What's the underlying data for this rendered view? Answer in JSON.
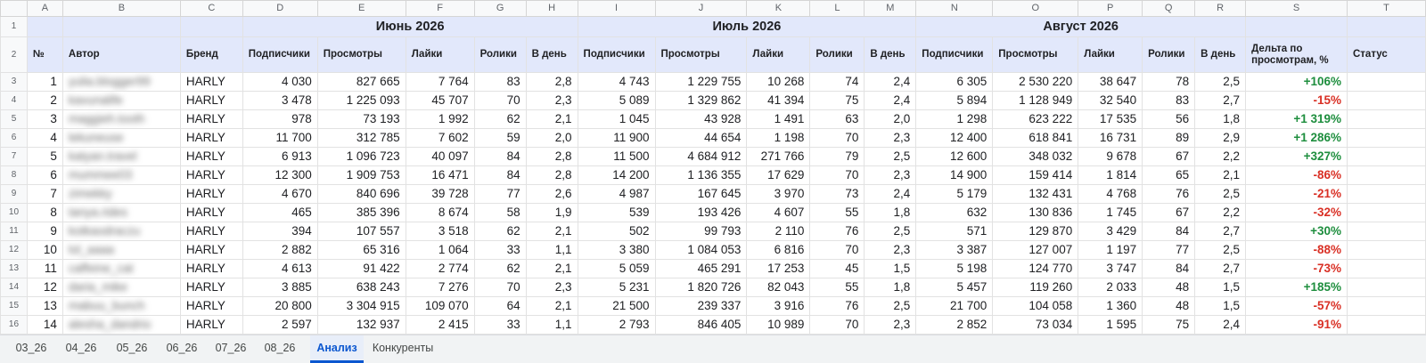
{
  "columns": [
    "A",
    "B",
    "C",
    "D",
    "E",
    "F",
    "G",
    "H",
    "I",
    "J",
    "K",
    "L",
    "M",
    "N",
    "O",
    "P",
    "Q",
    "R",
    "S",
    "T"
  ],
  "header": {
    "row_numbers": [
      "1",
      "2"
    ],
    "months": [
      "Июнь 2026",
      "Июль 2026",
      "Август 2026"
    ],
    "labels": {
      "no": "№",
      "author": "Автор",
      "brand": "Бренд",
      "subscribers": "Подписчики",
      "views": "Просмотры",
      "likes": "Лайки",
      "videos": "Ролики",
      "per_day": "В день",
      "delta": "Дельта по просмотрам, %",
      "status": "Статус"
    }
  },
  "rows": [
    {
      "rn": "3",
      "no": "1",
      "author": "yulia.blogger99",
      "brand": "HARLY",
      "m1": [
        "4 030",
        "827 665",
        "7 764",
        "83",
        "2,8"
      ],
      "m2": [
        "4 743",
        "1 229 755",
        "10 268",
        "74",
        "2,4"
      ],
      "m3": [
        "6 305",
        "2 530 220",
        "38 647",
        "78",
        "2,5"
      ],
      "delta": "+106%",
      "status": ""
    },
    {
      "rn": "4",
      "no": "2",
      "author": "kavunalife",
      "brand": "HARLY",
      "m1": [
        "3 478",
        "1 225 093",
        "45 707",
        "70",
        "2,3"
      ],
      "m2": [
        "5 089",
        "1 329 862",
        "41 394",
        "75",
        "2,4"
      ],
      "m3": [
        "5 894",
        "1 128 949",
        "32 540",
        "83",
        "2,7"
      ],
      "delta": "-15%",
      "status": ""
    },
    {
      "rn": "5",
      "no": "3",
      "author": "maggieh.tooth",
      "brand": "HARLY",
      "m1": [
        "978",
        "73 193",
        "1 992",
        "62",
        "2,1"
      ],
      "m2": [
        "1 045",
        "43 928",
        "1 491",
        "63",
        "2,0"
      ],
      "m3": [
        "1 298",
        "623 222",
        "17 535",
        "56",
        "1,8"
      ],
      "delta": "+1 319%",
      "status": ""
    },
    {
      "rn": "6",
      "no": "4",
      "author": "lekuneuse",
      "brand": "HARLY",
      "m1": [
        "11 700",
        "312 785",
        "7 602",
        "59",
        "2,0"
      ],
      "m2": [
        "11 900",
        "44 654",
        "1 198",
        "70",
        "2,3"
      ],
      "m3": [
        "12 400",
        "618 841",
        "16 731",
        "89",
        "2,9"
      ],
      "delta": "+1 286%",
      "status": ""
    },
    {
      "rn": "7",
      "no": "5",
      "author": "katyan.travel",
      "brand": "HARLY",
      "m1": [
        "6 913",
        "1 096 723",
        "40 097",
        "84",
        "2,8"
      ],
      "m2": [
        "11 500",
        "4 684 912",
        "271 766",
        "79",
        "2,5"
      ],
      "m3": [
        "12 600",
        "348 032",
        "9 678",
        "67",
        "2,2"
      ],
      "delta": "+327%",
      "status": ""
    },
    {
      "rn": "8",
      "no": "6",
      "author": "mummee03",
      "brand": "HARLY",
      "m1": [
        "12 300",
        "1 909 753",
        "16 471",
        "84",
        "2,8"
      ],
      "m2": [
        "14 200",
        "1 136 355",
        "17 629",
        "70",
        "2,3"
      ],
      "m3": [
        "14 900",
        "159 414",
        "1 814",
        "65",
        "2,1"
      ],
      "delta": "-86%",
      "status": ""
    },
    {
      "rn": "9",
      "no": "7",
      "author": "zimekky",
      "brand": "HARLY",
      "m1": [
        "4 670",
        "840 696",
        "39 728",
        "77",
        "2,6"
      ],
      "m2": [
        "4 987",
        "167 645",
        "3 970",
        "73",
        "2,4"
      ],
      "m3": [
        "5 179",
        "132 431",
        "4 768",
        "76",
        "2,5"
      ],
      "delta": "-21%",
      "status": ""
    },
    {
      "rn": "10",
      "no": "8",
      "author": "tanya.rides",
      "brand": "HARLY",
      "m1": [
        "465",
        "385 396",
        "8 674",
        "58",
        "1,9"
      ],
      "m2": [
        "539",
        "193 426",
        "4 607",
        "55",
        "1,8"
      ],
      "m3": [
        "632",
        "130 836",
        "1 745",
        "67",
        "2,2"
      ],
      "delta": "-32%",
      "status": ""
    },
    {
      "rn": "11",
      "no": "9",
      "author": "kotkaodraczu",
      "brand": "HARLY",
      "m1": [
        "394",
        "107 557",
        "3 518",
        "62",
        "2,1"
      ],
      "m2": [
        "502",
        "99 793",
        "2 110",
        "76",
        "2,5"
      ],
      "m3": [
        "571",
        "129 870",
        "3 429",
        "84",
        "2,7"
      ],
      "delta": "+30%",
      "status": ""
    },
    {
      "rn": "12",
      "no": "10",
      "author": "lol_aaaa",
      "brand": "HARLY",
      "m1": [
        "2 882",
        "65 316",
        "1 064",
        "33",
        "1,1"
      ],
      "m2": [
        "3 380",
        "1 084 053",
        "6 816",
        "70",
        "2,3"
      ],
      "m3": [
        "3 387",
        "127 007",
        "1 197",
        "77",
        "2,5"
      ],
      "delta": "-88%",
      "status": ""
    },
    {
      "rn": "13",
      "no": "11",
      "author": "caffeine_cat",
      "brand": "HARLY",
      "m1": [
        "4 613",
        "91 422",
        "2 774",
        "62",
        "2,1"
      ],
      "m2": [
        "5 059",
        "465 291",
        "17 253",
        "45",
        "1,5"
      ],
      "m3": [
        "5 198",
        "124 770",
        "3 747",
        "84",
        "2,7"
      ],
      "delta": "-73%",
      "status": ""
    },
    {
      "rn": "14",
      "no": "12",
      "author": "daria_mike",
      "brand": "HARLY",
      "m1": [
        "3 885",
        "638 243",
        "7 276",
        "70",
        "2,3"
      ],
      "m2": [
        "5 231",
        "1 820 726",
        "82 043",
        "55",
        "1,8"
      ],
      "m3": [
        "5 457",
        "119 260",
        "2 033",
        "48",
        "1,5"
      ],
      "delta": "+185%",
      "status": ""
    },
    {
      "rn": "15",
      "no": "13",
      "author": "mabuu_bunch",
      "brand": "HARLY",
      "m1": [
        "20 800",
        "3 304 915",
        "109 070",
        "64",
        "2,1"
      ],
      "m2": [
        "21 500",
        "239 337",
        "3 916",
        "76",
        "2,5"
      ],
      "m3": [
        "21 700",
        "104 058",
        "1 360",
        "48",
        "1,5"
      ],
      "delta": "-57%",
      "status": ""
    },
    {
      "rn": "16",
      "no": "14",
      "author": "alesha_dandrio",
      "brand": "HARLY",
      "m1": [
        "2 597",
        "132 937",
        "2 415",
        "33",
        "1,1"
      ],
      "m2": [
        "2 793",
        "846 405",
        "10 989",
        "70",
        "2,3"
      ],
      "m3": [
        "2 852",
        "73 034",
        "1 595",
        "75",
        "2,4"
      ],
      "delta": "-91%",
      "status": ""
    }
  ],
  "tabs": [
    "03_26",
    "04_26",
    "05_26",
    "06_26",
    "07_26",
    "08_26",
    "Анализ",
    "Конкуренты"
  ],
  "active_tab": "Анализ",
  "colors": {
    "positive": "#1e8e3e",
    "negative": "#d93025",
    "header_bg": "#e2e8fb",
    "active_tab": "#0b57d0"
  }
}
